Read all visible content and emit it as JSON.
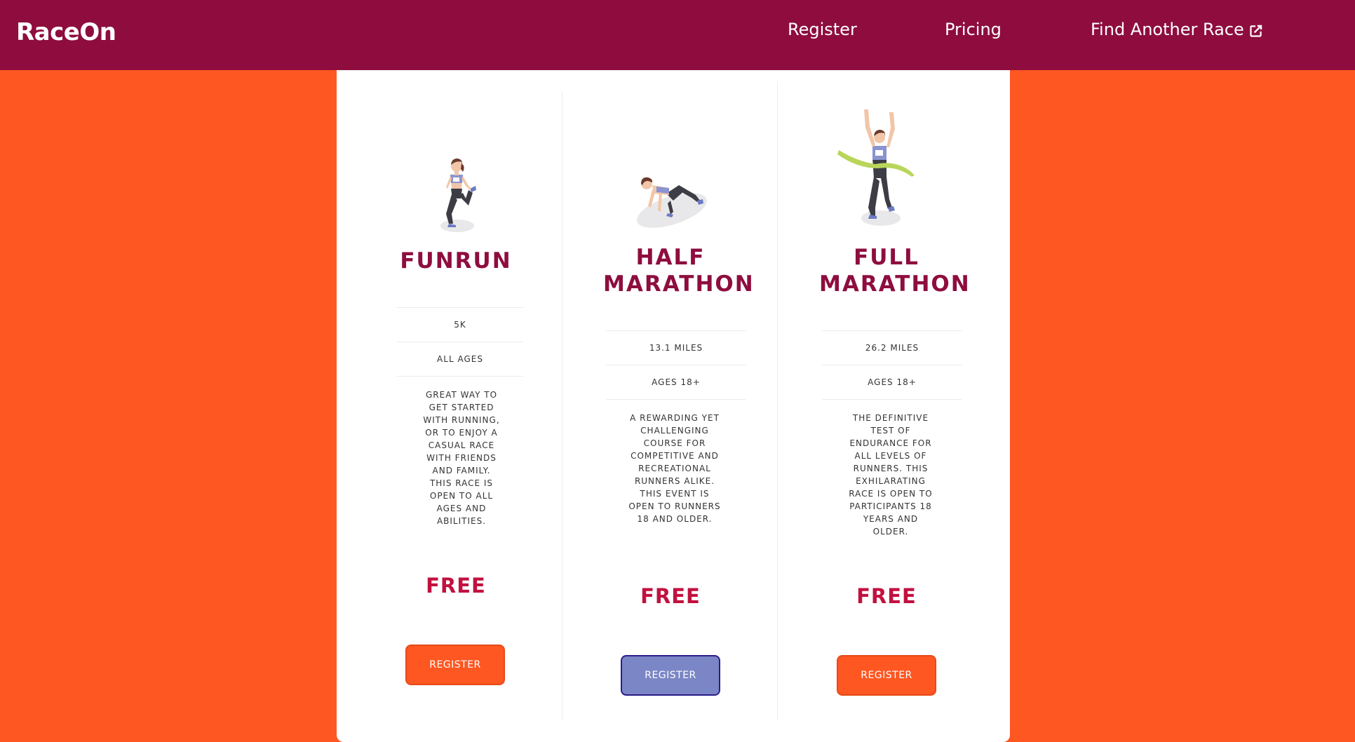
{
  "navbar": {
    "brand": "RaceOn",
    "links": {
      "register": "Register",
      "pricing": "Pricing",
      "find_another_race": "Find Another Race"
    },
    "external_link_icon": "external-link-icon"
  },
  "races": [
    {
      "title_line1": "FUNRUN",
      "title_line2": "",
      "distance": "5K",
      "ages": "ALL AGES",
      "description": "GREAT WAY TO GET STARTED WITH RUNNING, OR TO ENJOY A CASUAL RACE WITH FRIENDS AND FAMILY. THIS RACE IS OPEN TO ALL AGES AND ABILITIES.",
      "price": "FREE",
      "button": "REGISTER",
      "illustration": "runner-stretching-illustration"
    },
    {
      "title_line1": "HALF",
      "title_line2": "MARATHON",
      "distance": "13.1 MILES",
      "ages": "AGES 18+",
      "description": "A REWARDING YET CHALLENGING COURSE FOR COMPETITIVE AND RECREATIONAL RUNNERS ALIKE. THIS EVENT IS OPEN TO RUNNERS 18 AND OLDER.",
      "price": "FREE",
      "button": "REGISTER",
      "illustration": "runner-starting-block-illustration"
    },
    {
      "title_line1": "FULL",
      "title_line2": "MARATHON",
      "distance": "26.2 MILES",
      "ages": "AGES 18+",
      "description": "THE DEFINITIVE TEST OF ENDURANCE FOR ALL LEVELS OF RUNNERS. THIS EXHILARATING RACE IS OPEN TO PARTICIPANTS 18 YEARS AND OLDER.",
      "price": "FREE",
      "button": "REGISTER",
      "illustration": "runner-finish-line-illustration"
    }
  ],
  "colors": {
    "page_background": "#ff5722",
    "navbar_background": "#8e0d3e",
    "title_color": "#8e0d3e",
    "price_color": "#c2113f",
    "button_color": "#ff5722",
    "button_active_color": "#7b86c6"
  }
}
